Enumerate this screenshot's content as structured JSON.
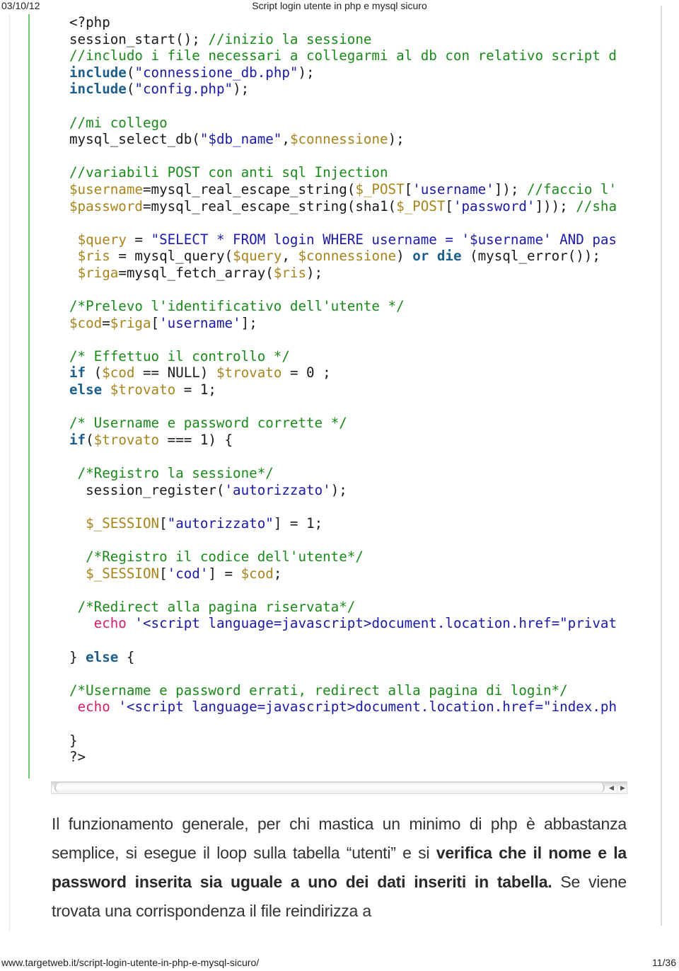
{
  "header": {
    "date": "03/10/12",
    "title": "Script login utente in php e mysql sicuro"
  },
  "code": {
    "language": "php",
    "lines": [
      [
        {
          "t": "plain",
          "s": "<?php"
        }
      ],
      [
        {
          "t": "plain",
          "s": "session_start(); "
        },
        {
          "t": "comment",
          "s": "//inizio la sessione"
        }
      ],
      [
        {
          "t": "comment",
          "s": "//includo i file necessari a collegarmi al db con relativo script d"
        }
      ],
      [
        {
          "t": "kw",
          "s": "include"
        },
        {
          "t": "plain",
          "s": "("
        },
        {
          "t": "str",
          "s": "\"connessione_db.php\""
        },
        {
          "t": "plain",
          "s": ");"
        }
      ],
      [
        {
          "t": "kw",
          "s": "include"
        },
        {
          "t": "plain",
          "s": "("
        },
        {
          "t": "str",
          "s": "\"config.php\""
        },
        {
          "t": "plain",
          "s": ");"
        }
      ],
      [],
      [
        {
          "t": "comment",
          "s": "//mi collego"
        }
      ],
      [
        {
          "t": "plain",
          "s": "mysql_select_db("
        },
        {
          "t": "str",
          "s": "\"$db_name\""
        },
        {
          "t": "plain",
          "s": ","
        },
        {
          "t": "var",
          "s": "$connessione"
        },
        {
          "t": "plain",
          "s": ");"
        }
      ],
      [],
      [
        {
          "t": "comment",
          "s": "//variabili POST con anti sql Injection"
        }
      ],
      [
        {
          "t": "var",
          "s": "$username"
        },
        {
          "t": "plain",
          "s": "=mysql_real_escape_string("
        },
        {
          "t": "var",
          "s": "$_POST"
        },
        {
          "t": "plain",
          "s": "["
        },
        {
          "t": "str",
          "s": "'username'"
        },
        {
          "t": "plain",
          "s": "]); "
        },
        {
          "t": "comment",
          "s": "//faccio l'"
        }
      ],
      [
        {
          "t": "var",
          "s": "$password"
        },
        {
          "t": "plain",
          "s": "=mysql_real_escape_string(sha1("
        },
        {
          "t": "var",
          "s": "$_POST"
        },
        {
          "t": "plain",
          "s": "["
        },
        {
          "t": "str",
          "s": "'password'"
        },
        {
          "t": "plain",
          "s": "])); "
        },
        {
          "t": "comment",
          "s": "//sha"
        }
      ],
      [],
      [
        {
          "t": "plain",
          "s": " "
        },
        {
          "t": "var",
          "s": "$query"
        },
        {
          "t": "plain",
          "s": " = "
        },
        {
          "t": "str",
          "s": "\"SELECT * FROM login WHERE username = '$username' AND pas"
        }
      ],
      [
        {
          "t": "plain",
          "s": " "
        },
        {
          "t": "var",
          "s": "$ris"
        },
        {
          "t": "plain",
          "s": " = mysql_query("
        },
        {
          "t": "var",
          "s": "$query"
        },
        {
          "t": "plain",
          "s": ", "
        },
        {
          "t": "var",
          "s": "$connessione"
        },
        {
          "t": "plain",
          "s": ") "
        },
        {
          "t": "kw",
          "s": "or die"
        },
        {
          "t": "plain",
          "s": " (mysql_error());"
        }
      ],
      [
        {
          "t": "plain",
          "s": " "
        },
        {
          "t": "var",
          "s": "$riga"
        },
        {
          "t": "plain",
          "s": "=mysql_fetch_array("
        },
        {
          "t": "var",
          "s": "$ris"
        },
        {
          "t": "plain",
          "s": ");"
        }
      ],
      [],
      [
        {
          "t": "comment",
          "s": "/*Prelevo l'identificativo dell'utente */"
        }
      ],
      [
        {
          "t": "var",
          "s": "$cod"
        },
        {
          "t": "plain",
          "s": "="
        },
        {
          "t": "var",
          "s": "$riga"
        },
        {
          "t": "plain",
          "s": "["
        },
        {
          "t": "str",
          "s": "'username'"
        },
        {
          "t": "plain",
          "s": "];"
        }
      ],
      [],
      [
        {
          "t": "comment",
          "s": "/* Effettuo il controllo */"
        }
      ],
      [
        {
          "t": "kw",
          "s": "if"
        },
        {
          "t": "plain",
          "s": " ("
        },
        {
          "t": "var",
          "s": "$cod"
        },
        {
          "t": "plain",
          "s": " == NULL) "
        },
        {
          "t": "var",
          "s": "$trovato"
        },
        {
          "t": "plain",
          "s": " = 0 ;"
        }
      ],
      [
        {
          "t": "kw",
          "s": "else"
        },
        {
          "t": "plain",
          "s": " "
        },
        {
          "t": "var",
          "s": "$trovato"
        },
        {
          "t": "plain",
          "s": " = 1;"
        }
      ],
      [],
      [
        {
          "t": "comment",
          "s": "/* Username e password corrette */"
        }
      ],
      [
        {
          "t": "kw",
          "s": "if"
        },
        {
          "t": "plain",
          "s": "("
        },
        {
          "t": "var",
          "s": "$trovato"
        },
        {
          "t": "plain",
          "s": " === 1) {"
        }
      ],
      [],
      [
        {
          "t": "plain",
          "s": " "
        },
        {
          "t": "comment",
          "s": "/*Registro la sessione*/"
        }
      ],
      [
        {
          "t": "plain",
          "s": "  session_register("
        },
        {
          "t": "str",
          "s": "'autorizzato'"
        },
        {
          "t": "plain",
          "s": ");"
        }
      ],
      [],
      [
        {
          "t": "plain",
          "s": "  "
        },
        {
          "t": "var",
          "s": "$_SESSION"
        },
        {
          "t": "plain",
          "s": "["
        },
        {
          "t": "str",
          "s": "\"autorizzato\""
        },
        {
          "t": "plain",
          "s": "] = 1;"
        }
      ],
      [],
      [
        {
          "t": "plain",
          "s": "  "
        },
        {
          "t": "comment",
          "s": "/*Registro il codice dell'utente*/"
        }
      ],
      [
        {
          "t": "plain",
          "s": "  "
        },
        {
          "t": "var",
          "s": "$_SESSION"
        },
        {
          "t": "plain",
          "s": "["
        },
        {
          "t": "str",
          "s": "'cod'"
        },
        {
          "t": "plain",
          "s": "] = "
        },
        {
          "t": "var",
          "s": "$cod"
        },
        {
          "t": "plain",
          "s": ";"
        }
      ],
      [],
      [
        {
          "t": "plain",
          "s": " "
        },
        {
          "t": "comment",
          "s": "/*Redirect alla pagina riservata*/"
        }
      ],
      [
        {
          "t": "plain",
          "s": "   "
        },
        {
          "t": "echo",
          "s": "echo"
        },
        {
          "t": "plain",
          "s": " "
        },
        {
          "t": "str",
          "s": "'<script language=javascript>document.location.href=\"privat"
        }
      ],
      [],
      [
        {
          "t": "plain",
          "s": "} "
        },
        {
          "t": "kw",
          "s": "else"
        },
        {
          "t": "plain",
          "s": " {"
        }
      ],
      [],
      [
        {
          "t": "comment",
          "s": "/*Username e password errati, redirect alla pagina di login*/"
        }
      ],
      [
        {
          "t": "plain",
          "s": " "
        },
        {
          "t": "echo",
          "s": "echo"
        },
        {
          "t": "plain",
          "s": " "
        },
        {
          "t": "str",
          "s": "'<script language=javascript>document.location.href=\"index.ph"
        }
      ],
      [],
      [
        {
          "t": "plain",
          "s": "}"
        }
      ],
      [
        {
          "t": "plain",
          "s": "?>"
        }
      ]
    ]
  },
  "scrollbar": {
    "left_arrow": "◀",
    "right_arrow": "▶"
  },
  "article": {
    "paragraph": [
      {
        "bold": false,
        "text": "Il funzionamento generale, per chi mastica un minimo di php è abbastanza semplice, si esegue il loop sulla tabella “utenti”  e si "
      },
      {
        "bold": true,
        "text": "verifica che  il nome e la password inserita sia uguale a uno dei dati inseriti in tabella."
      },
      {
        "bold": false,
        "text": " Se viene trovata una corrispondenza il file reindirizza a"
      }
    ]
  },
  "footer": {
    "url": "www.targetweb.it/script-login-utente-in-php-e-mysql-sicuro/",
    "page": "11/36"
  }
}
